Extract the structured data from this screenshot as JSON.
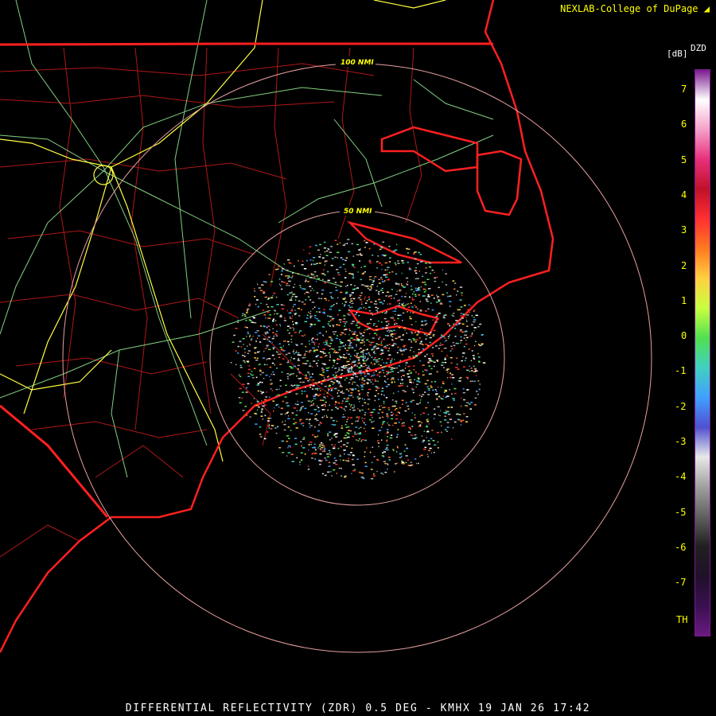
{
  "credit": "NEXLAB-College of DuPage",
  "product_code": "DZD",
  "unit": "[dB]",
  "legend_ticks": [
    "7",
    "6",
    "5",
    "4",
    "3",
    "2",
    "1",
    "0",
    "-1",
    "-2",
    "-3",
    "-4",
    "-5",
    "-6",
    "-7"
  ],
  "legend_th": "TH",
  "range_rings": [
    "100 NMI",
    "50 NMI"
  ],
  "footer": "DIFFERENTIAL REFLECTIVITY (ZDR) 0.5 DEG - KMHX 19 JAN 26 17:42",
  "colors": {
    "state_border": "#ff2020",
    "county_lines": "#b01818",
    "highways": "#ffff40",
    "roads": "#90e890",
    "range_ring": "#e8a0a0",
    "legend_text": "#ffff00"
  },
  "legend_colors": [
    "#7a1b8f",
    "#ffffff",
    "#f4a0c8",
    "#e8307a",
    "#c0102a",
    "#ff3030",
    "#ff7a20",
    "#ffd040",
    "#c8ff40",
    "#50e050",
    "#40d0c0",
    "#40a0ff",
    "#5050d0",
    "#e8e8e8",
    "#a0a0a0",
    "#606060",
    "#202020",
    "#201028",
    "#3a1050",
    "#6a1a80"
  ]
}
